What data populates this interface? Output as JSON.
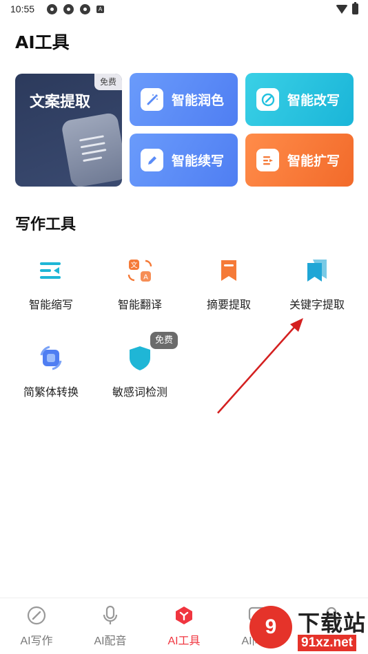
{
  "status_bar": {
    "time": "10:55",
    "icons_left": [
      "notification-icon",
      "notification-icon",
      "notification-icon",
      "a-icon"
    ],
    "icons_right": [
      "wifi-icon",
      "battery-icon"
    ]
  },
  "page": {
    "title": "AI工具"
  },
  "ai_tools": {
    "featured": {
      "label": "文案提取",
      "badge": "免费"
    },
    "cards": [
      {
        "label": "智能润色",
        "icon": "magic-wand-icon",
        "color": "#5b8cf7"
      },
      {
        "label": "智能改写",
        "icon": "edit-circle-icon",
        "color": "#22c1df"
      },
      {
        "label": "智能续写",
        "icon": "pencil-icon",
        "color": "#5b8cf7"
      },
      {
        "label": "智能扩写",
        "icon": "expand-text-icon",
        "color": "#f57a38"
      }
    ]
  },
  "writing_tools": {
    "title": "写作工具",
    "items": [
      {
        "label": "智能缩写",
        "icon": "list-indent-icon",
        "color": "#1fb6d6"
      },
      {
        "label": "智能翻译",
        "icon": "translate-icon",
        "color": "#f57a38"
      },
      {
        "label": "摘要提取",
        "icon": "bookmark-icon",
        "color": "#f57a38"
      },
      {
        "label": "关键字提取",
        "icon": "bookmarks-icon",
        "color": "#1fa6d6"
      },
      {
        "label": "简繁体转换",
        "icon": "convert-icon",
        "color": "#4f7ef2"
      },
      {
        "label": "敏感词检测",
        "icon": "shield-icon",
        "color": "#1fb6d6"
      }
    ],
    "badge": "免费"
  },
  "bottom_nav": {
    "items": [
      {
        "label": "AI写作",
        "icon": "pen-circle-icon",
        "active": false
      },
      {
        "label": "AI配音",
        "icon": "microphone-icon",
        "active": false
      },
      {
        "label": "AI工具",
        "icon": "ai-tools-icon",
        "active": true
      },
      {
        "label": "AI问答",
        "icon": "chat-icon",
        "active": false
      },
      {
        "label": "我的",
        "icon": "profile-icon",
        "active": false
      }
    ]
  },
  "watermark": {
    "logo_text": "9",
    "title": "下载站",
    "url": "91xz.net"
  },
  "annotation": {
    "arrow_color": "#d42020"
  }
}
